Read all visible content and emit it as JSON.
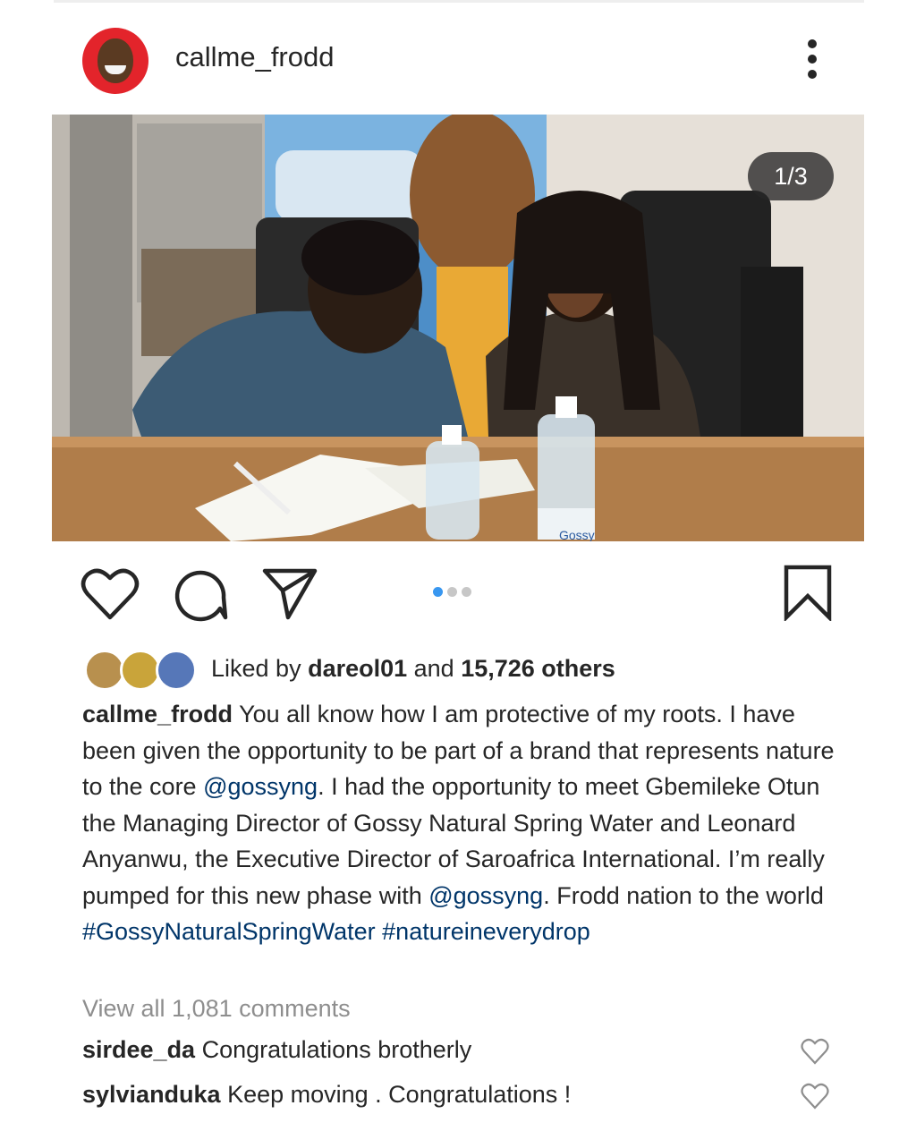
{
  "post": {
    "username": "callme_frodd",
    "image_counter": "1/3",
    "carousel": {
      "total": 3,
      "active_index": 0
    },
    "bottle_label": "Gossy"
  },
  "actions": {
    "like_icon": "heart-outline-icon",
    "comment_icon": "comment-bubble-icon",
    "share_icon": "paper-plane-icon",
    "save_icon": "bookmark-icon"
  },
  "likes": {
    "prefix": "Liked by ",
    "first_user": "dareol01",
    "middle": " and ",
    "count_text": "15,726 others"
  },
  "caption": {
    "username": "callme_frodd",
    "text_1": " You all know how I am protective of my roots. I have been given the opportunity to be part of a brand that represents nature to the core ",
    "mention_1": "@gossyng",
    "text_2": ". I had the opportunity to meet Gbemileke Otun the Managing Director of Gossy Natural Spring Water and Leonard Anyanwu, the Executive Director of Saroafrica International. I’m really pumped for this new phase with ",
    "mention_2": "@gossyng",
    "text_3": ". Frodd nation to the world ",
    "hashtag_1": "#GossyNaturalSpringWater",
    "hashtag_2": "#natureineverydrop"
  },
  "view_all_comments": "View all 1,081 comments",
  "comments": [
    {
      "user": "sirdee_da",
      "text": " Congratulations brotherly"
    },
    {
      "user": "sylvianduka",
      "text": " Keep moving . Congratulations !"
    }
  ]
}
